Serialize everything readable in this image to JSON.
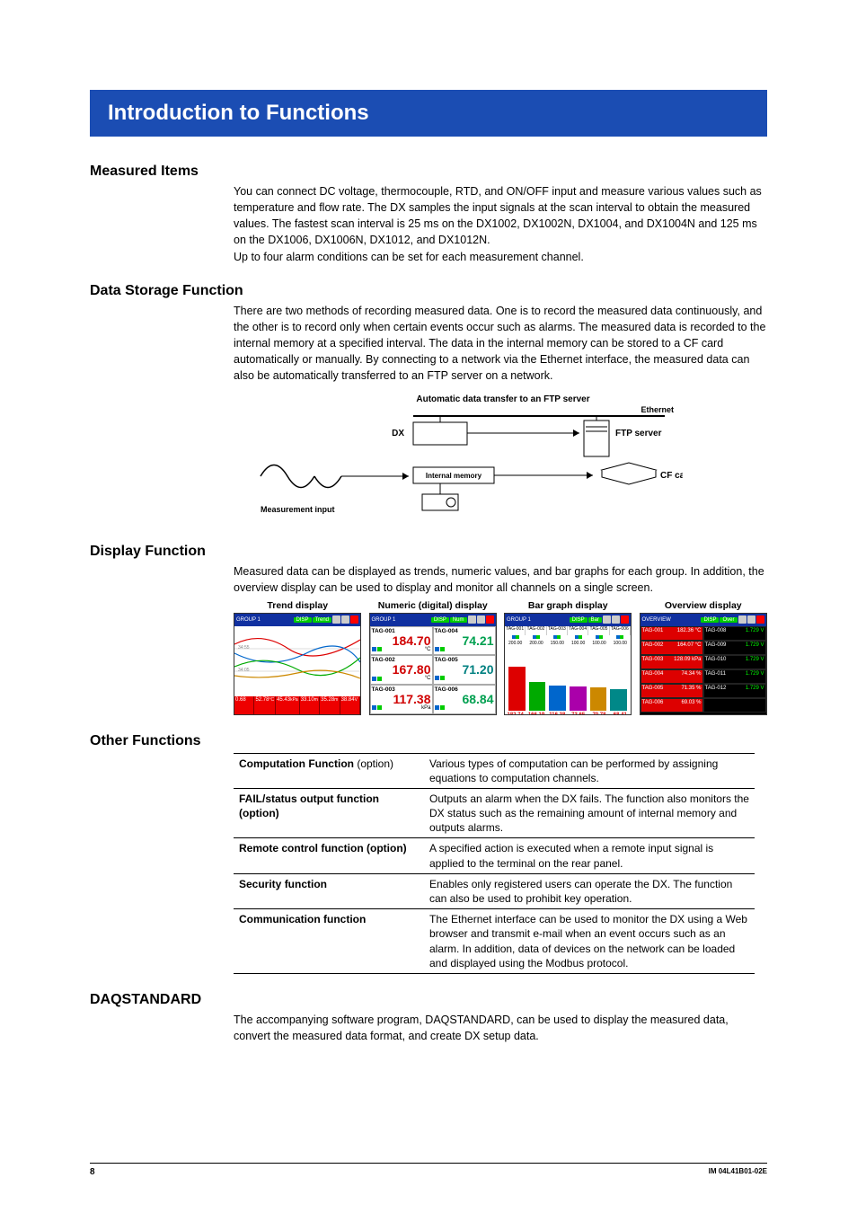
{
  "title": "Introduction to Functions",
  "sections": {
    "measured": {
      "heading": "Measured Items",
      "body": "You can connect DC voltage, thermocouple, RTD, and ON/OFF input and measure various values such as temperature and flow rate. The DX samples the input signals at the scan interval to obtain the measured values. The fastest scan interval is 25 ms on the DX1002, DX1002N, DX1004, and DX1004N and 125 ms on the DX1006, DX1006N, DX1012, and DX1012N.\nUp to four alarm conditions can be set for each measurement channel."
    },
    "storage": {
      "heading": "Data Storage Function",
      "body": "There are two methods of recording measured data. One is to record the measured data continuously, and the other is to record only when certain events occur such as alarms. The measured data is recorded to the internal memory at a specified interval. The data in the internal memory can be stored to a CF card automatically or manually. By connecting to a network via the Ethernet interface, the measured data can also be automatically transferred to an FTP server on a network.",
      "diagram": {
        "title": "Automatic data transfer to an FTP server",
        "dx": "DX",
        "ftp": "FTP server",
        "ethernet": "Ethernet",
        "internal": "Internal memory",
        "cfcard": "CF card",
        "measurement": "Measurement input"
      }
    },
    "display": {
      "heading": "Display Function",
      "body": "Measured data can be displayed as trends, numeric values, and bar graphs for each group. In addition, the overview display can be used to display and monitor all channels on a single screen.",
      "titles": [
        "Trend display",
        "Numeric (digital) display",
        "Bar graph display",
        "Overview display"
      ],
      "trend": {
        "bottom": [
          "0.68",
          "52.78",
          "45.43",
          "33.10",
          "35.28",
          "38.84"
        ],
        "units": [
          "",
          "°C",
          "kPa",
          "m",
          "m",
          "V"
        ]
      },
      "numeric": {
        "cells": [
          {
            "tag": "TAG-001",
            "val": "184.70",
            "unit": "°C",
            "color": "#d00000"
          },
          {
            "tag": "TAG-004",
            "val": "74.21",
            "unit": "",
            "color": "#00a050"
          },
          {
            "tag": "TAG-002",
            "val": "167.80",
            "unit": "°C",
            "color": "#d00000"
          },
          {
            "tag": "TAG-005",
            "val": "71.20",
            "unit": "",
            "color": "#008080"
          },
          {
            "tag": "TAG-003",
            "val": "117.38",
            "unit": "kPa",
            "color": "#d00000"
          },
          {
            "tag": "TAG-006",
            "val": "68.84",
            "unit": "",
            "color": "#00a050"
          }
        ]
      },
      "bar": {
        "top": [
          "TAG-001",
          "TAG-002",
          "TAG-003",
          "TAG-004",
          "TAG-005",
          "TAG-006"
        ],
        "heights": [
          70,
          45,
          40,
          38,
          36,
          33
        ],
        "colors": [
          "#d00",
          "#0a0",
          "#06c",
          "#a0a",
          "#c80",
          "#088"
        ],
        "bot": [
          "182.74",
          "166.19",
          "116.38",
          "73.65",
          "70.78",
          "68.41"
        ],
        "scales": [
          "200.00",
          "200.00",
          "150.00",
          "100.00",
          "100.00",
          "100.00"
        ]
      },
      "overview": {
        "cells": [
          {
            "tag": "TAG-001",
            "val": "182.36 °C",
            "cls": "red"
          },
          {
            "tag": "TAG-008",
            "val": "1.729 V",
            "cls": "blk"
          },
          {
            "tag": "TAG-002",
            "val": "164.07 °C",
            "cls": "red"
          },
          {
            "tag": "TAG-009",
            "val": "1.729 V",
            "cls": "blk"
          },
          {
            "tag": "TAG-003",
            "val": "128.09 kPa",
            "cls": "red"
          },
          {
            "tag": "TAG-010",
            "val": "1.729 V",
            "cls": "blk"
          },
          {
            "tag": "TAG-004",
            "val": "74.34 %",
            "cls": "red"
          },
          {
            "tag": "TAG-011",
            "val": "1.729 V",
            "cls": "blk"
          },
          {
            "tag": "TAG-005",
            "val": "71.35 %",
            "cls": "red"
          },
          {
            "tag": "TAG-012",
            "val": "1.729 V",
            "cls": "blk"
          },
          {
            "tag": "TAG-006",
            "val": "69.03 %",
            "cls": "red"
          },
          {
            "tag": "",
            "val": "",
            "cls": "blk"
          }
        ]
      }
    },
    "other": {
      "heading": "Other Functions",
      "rows": [
        {
          "name": "Computation Function",
          "opt": " (option)",
          "desc": "Various types of computation can be performed by assigning equations to computation channels."
        },
        {
          "name": "FAIL/status output function (option)",
          "opt": "",
          "desc": "Outputs an alarm when the DX fails. The function also monitors the DX status such as the remaining amount of internal memory and outputs alarms."
        },
        {
          "name": "Remote control function (option)",
          "opt": "",
          "desc": "A specified action is executed when a remote input signal is applied to the terminal on the rear panel."
        },
        {
          "name": "Security function",
          "opt": "",
          "desc": "Enables only registered users can operate the DX. The function can also be used to prohibit key operation."
        },
        {
          "name": "Communication function",
          "opt": "",
          "desc": "The Ethernet interface can be used to monitor the DX using a Web browser and transmit e-mail when an event occurs such as an alarm. In addition, data of devices on the network can be loaded and displayed using the Modbus protocol."
        }
      ]
    },
    "daq": {
      "heading": "DAQSTANDARD",
      "body": "The accompanying software program, DAQSTANDARD, can be used to display the measured data, convert the measured data format, and create DX setup data."
    }
  },
  "footer": {
    "page": "8",
    "docid": "IM 04L41B01-02E"
  }
}
